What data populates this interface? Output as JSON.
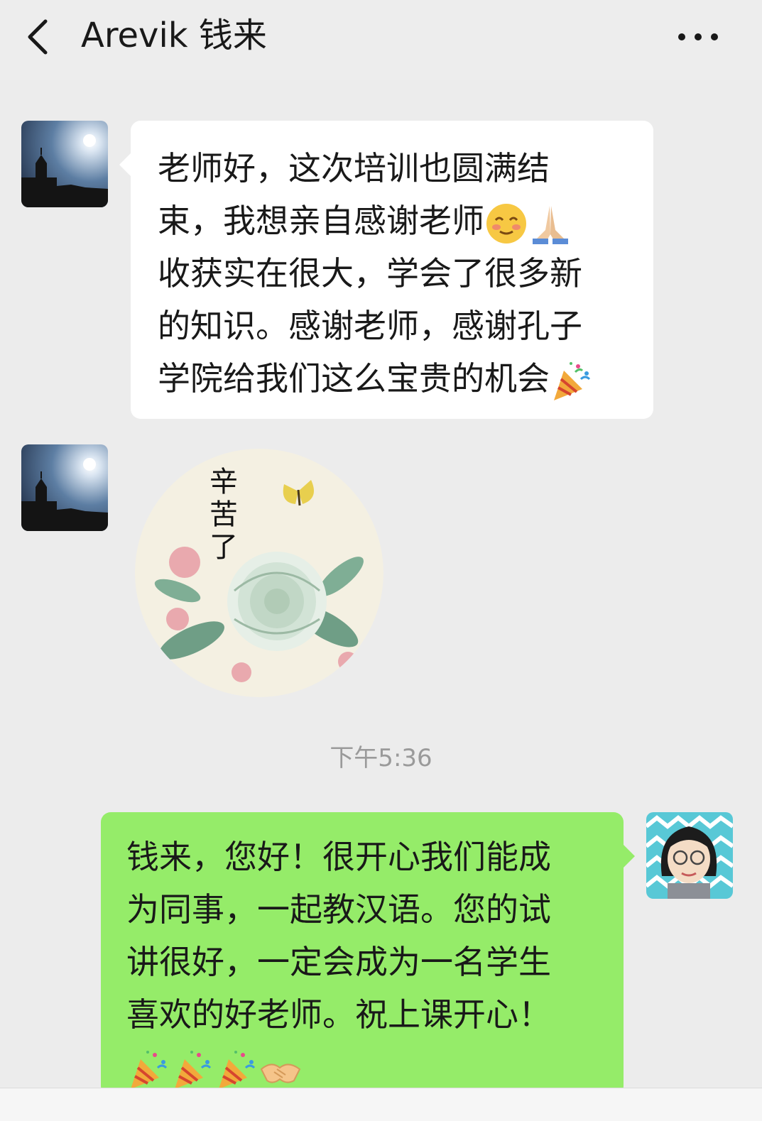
{
  "header": {
    "title": "Arevik 钱来"
  },
  "messages": [
    {
      "sender": "contact",
      "lines": [
        "老师好，这次培训也圆满结",
        "束，我想亲自感谢老师",
        "收获实在很大，学会了很多新",
        "的知识。感谢老师，感谢孔子",
        "学院给我们这么宝贵的机会"
      ]
    },
    {
      "sender": "contact",
      "sticker_text": "辛苦了"
    },
    {
      "timestamp": "下午5:36"
    },
    {
      "sender": "me",
      "lines": [
        "钱来，您好！很开心我们能成",
        "为同事，一起教汉语。您的试",
        "讲很好，一定会成为一名学生",
        "喜欢的好老师。祝上课开心！"
      ]
    }
  ],
  "colors": {
    "background": "#ececec",
    "incoming_bubble": "#ffffff",
    "outgoing_bubble": "#95ec69",
    "timestamp_text": "#9a9a9a"
  },
  "icons": [
    "back-chevron-icon",
    "more-dots-icon",
    "smile-emoji-icon",
    "pray-emoji-icon",
    "party-popper-icon",
    "handshake-icon",
    "butterfly-icon",
    "peony-icon"
  ]
}
